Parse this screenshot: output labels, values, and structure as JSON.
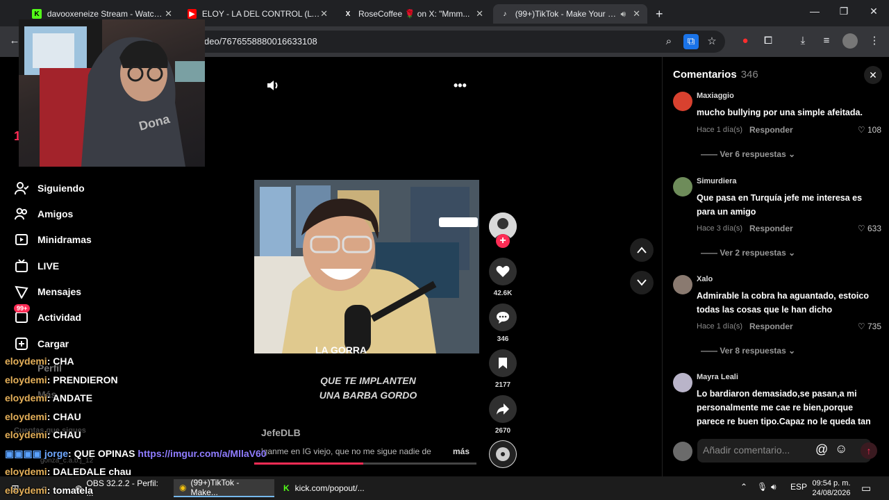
{
  "browser": {
    "tabs": [
      {
        "title": "davooxeneize Stream - Watch L",
        "favicon": "kick-icon",
        "color": "#53fc18",
        "letter": "K"
      },
      {
        "title": "ELOY - LA DEL CONTROL (LYRIC",
        "favicon": "youtube-icon",
        "color": "#ff0000",
        "letter": "▶"
      },
      {
        "title": "RoseCoffee 🌹 on X: \"Mmm...",
        "favicon": "x-icon",
        "color": "#ffffff",
        "letter": "X"
      },
      {
        "title": "(99+)TikTok - Make Your Da",
        "favicon": "tiktok-icon",
        "color": "#ffffff",
        "letter": "♪"
      }
    ],
    "new_tab": "+",
    "url": "deo/7676558880016633108"
  },
  "sidebar": {
    "items": [
      {
        "label": "Siguiendo",
        "icon": "following-icon"
      },
      {
        "label": "Amigos",
        "icon": "friends-icon"
      },
      {
        "label": "Minidramas",
        "icon": "minidramas-icon"
      },
      {
        "label": "LIVE",
        "icon": "live-icon"
      },
      {
        "label": "Mensajes",
        "icon": "messages-icon"
      },
      {
        "label": "Actividad",
        "icon": "activity-icon",
        "badge": "99+"
      },
      {
        "label": "Cargar",
        "icon": "upload-icon"
      }
    ],
    "partial_top": "1",
    "perfil": "Perfil",
    "mas": "Más",
    "cuentas": "Cuentas que sigues",
    "follow_user": "gonza_c.a.b.j_12"
  },
  "video": {
    "caption_line1": "QUE TE IMPLANTEN",
    "caption_line2": "UNA BARBA GORDO",
    "author": "JefeDLB",
    "description": "lganme en IG viejo, que no me sigue nadie de",
    "more_label": "más",
    "progress": 0.49,
    "overlay_logo_text": "LA GORRA"
  },
  "actions": {
    "likes": "42.6K",
    "comments": "346",
    "saves": "2177",
    "shares": "2670"
  },
  "comments_panel": {
    "title": "Comentarios",
    "count": "346",
    "input_placeholder": "Añadir comentario...",
    "items": [
      {
        "user": "Maxiaggio",
        "text": "mucho bullying por una simple afeitada.",
        "time": "Hace 1 día(s)",
        "reply": "Responder",
        "likes": "108",
        "more": "Ver 6 respuestas",
        "avatar_color": "#d8412f"
      },
      {
        "user": "Simurdiera",
        "text": "Que pasa en Turquía jefe me interesa es para un amigo",
        "time": "Hace 3 día(s)",
        "reply": "Responder",
        "likes": "633",
        "more": "Ver 2 respuestas",
        "avatar_color": "#6e8c5a"
      },
      {
        "user": "Xalo",
        "text": "Admirable la cobra ha aguantado, estoico todas las cosas que le han dicho",
        "time": "Hace 1 día(s)",
        "reply": "Responder",
        "likes": "735",
        "more": "Ver 8 respuestas",
        "avatar_color": "#8a7a70"
      },
      {
        "user": "Mayra Leali",
        "text": "Lo bardiaron demasiado,se pasan,a mi personalmente me cae re bien,porque parece re buen tipo.Capaz no le queda tan",
        "avatar_color": "#b9b4c9"
      }
    ]
  },
  "chat": [
    {
      "name": "eloydemi",
      "msg": ": CHA"
    },
    {
      "name": "eloydemi",
      "msg": ": PRENDIERON"
    },
    {
      "name": "eloydemi",
      "msg": ": ANDATE"
    },
    {
      "name": "eloydemi",
      "msg": ": CHAU"
    },
    {
      "name": "eloydemi",
      "msg": ": CHAU"
    },
    {
      "name": "jorge",
      "msg": ": QUE OPINAS ",
      "link": "https://imgur.com/a/MllaV60"
    },
    {
      "name": "eloydemi",
      "msg": ": DALEDALE chau"
    },
    {
      "name": "eloydemi",
      "msg": ": tomatela"
    }
  ],
  "taskbar": {
    "apps": [
      {
        "label": "OBS 32.2.2 - Perfil: ...",
        "icon": "obs-icon"
      },
      {
        "label": "(99+)TikTok - Make...",
        "icon": "chrome-icon"
      },
      {
        "label": "kick.com/popout/...",
        "icon": "kick-icon"
      }
    ],
    "lang": "ESP",
    "time": "09:54 p. m.",
    "date": "24/08/2026"
  }
}
